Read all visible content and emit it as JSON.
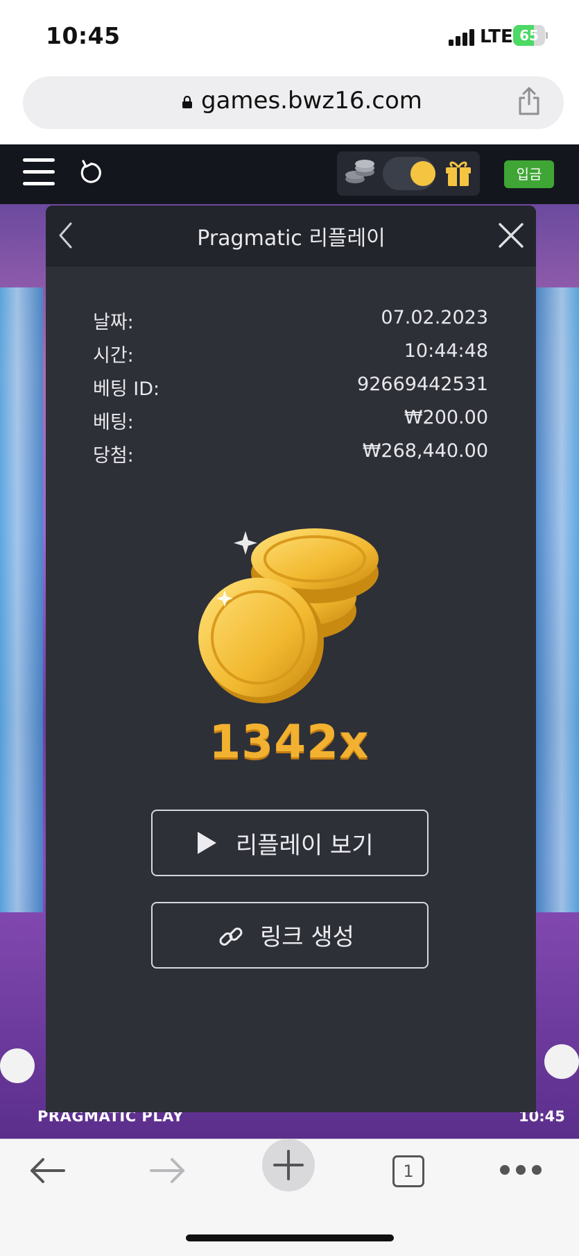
{
  "status_bar": {
    "time": "10:45",
    "network": "LTE",
    "battery": "65"
  },
  "browser": {
    "url": "games.bwz16.com",
    "open_tabs": "1"
  },
  "site_header": {
    "deposit_label": "입금"
  },
  "modal": {
    "title": "Pragmatic 리플레이",
    "rows": [
      {
        "label": "날짜:",
        "value": "07.02.2023"
      },
      {
        "label": "시간:",
        "value": "10:44:48"
      },
      {
        "label": "베팅 ID:",
        "value": "92669442531"
      },
      {
        "label": "베팅:",
        "value": "₩200.00"
      },
      {
        "label": "당첨:",
        "value": "₩268,440.00"
      }
    ],
    "multiplier": "1342x",
    "replay_button": "리플레이 보기",
    "link_button": "링크 생성"
  },
  "game": {
    "provider": "PRAGMATIC PLAY",
    "clock": "10:45"
  },
  "icons": {
    "lock": "lock-icon",
    "share": "share-icon",
    "menu": "hamburger-menu-icon",
    "reload": "reload-icon",
    "coins": "coin-stack-icon",
    "gift": "gift-icon",
    "back": "chevron-left-icon",
    "close": "close-icon",
    "play": "play-icon",
    "link": "link-icon"
  },
  "colors": {
    "deposit": "#3fa535",
    "multiplier": "#f2b130",
    "modal_bg": "#2e3038",
    "header_bg": "#14161d"
  }
}
